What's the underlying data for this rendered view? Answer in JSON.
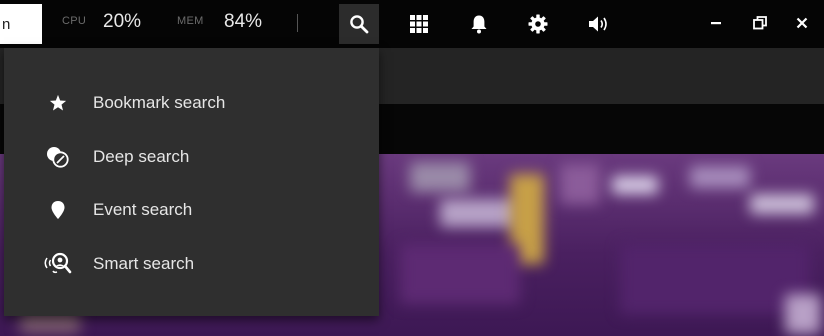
{
  "colors": {
    "topbar_bg": "#050505",
    "menu_bg": "#2f2f2f",
    "active_button_bg": "#2c2c2c",
    "text_primary": "#e6e6e6",
    "text_muted": "#6c6c6c"
  },
  "topbar": {
    "tab_text": "n",
    "cpu_label": "CPU",
    "cpu_value": "20%",
    "mem_label": "MEM",
    "mem_value": "84%",
    "buttons": [
      {
        "icon": "search-icon",
        "active": true
      },
      {
        "icon": "grid-icon"
      },
      {
        "icon": "bell-icon"
      },
      {
        "icon": "gear-icon"
      },
      {
        "icon": "volume-icon"
      }
    ],
    "window_controls": [
      {
        "icon": "minimize-icon"
      },
      {
        "icon": "restore-icon"
      },
      {
        "icon": "close-icon"
      }
    ]
  },
  "search_menu": {
    "items": [
      {
        "label": "Bookmark search",
        "icon": "star-icon"
      },
      {
        "label": "Deep search",
        "icon": "deep-search-icon"
      },
      {
        "label": "Event search",
        "icon": "location-pin-icon"
      },
      {
        "label": "Smart search",
        "icon": "smart-search-icon"
      }
    ]
  }
}
